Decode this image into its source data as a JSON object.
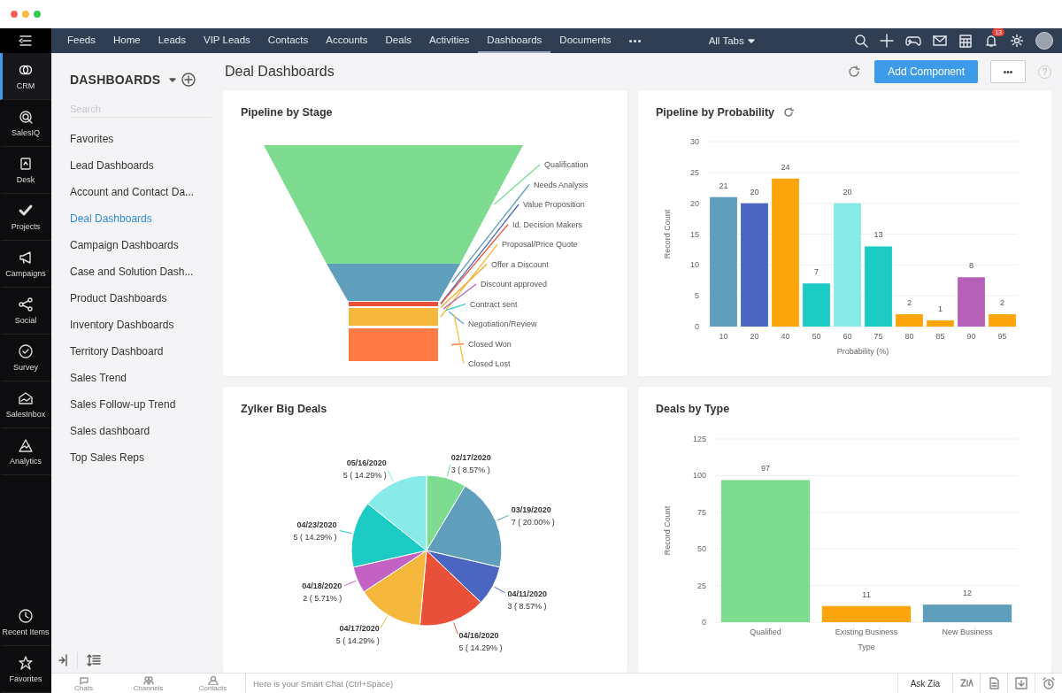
{
  "rail": {
    "items": [
      {
        "label": "CRM",
        "selected": true
      },
      {
        "label": "SalesIQ",
        "selected": false
      },
      {
        "label": "Desk",
        "selected": false
      },
      {
        "label": "Projects",
        "selected": false
      },
      {
        "label": "Campaigns",
        "selected": false
      },
      {
        "label": "Social",
        "selected": false
      },
      {
        "label": "Survey",
        "selected": false
      },
      {
        "label": "SalesInbox",
        "selected": false
      },
      {
        "label": "Analytics",
        "selected": false
      }
    ],
    "bottom_items": [
      {
        "label": "Recent Items"
      },
      {
        "label": "Favorites"
      }
    ]
  },
  "nav": {
    "tabs": [
      {
        "label": "Feeds",
        "selected": false
      },
      {
        "label": "Home",
        "selected": false
      },
      {
        "label": "Leads",
        "selected": false
      },
      {
        "label": "VIP Leads",
        "selected": false
      },
      {
        "label": "Contacts",
        "selected": false
      },
      {
        "label": "Accounts",
        "selected": false
      },
      {
        "label": "Deals",
        "selected": false
      },
      {
        "label": "Activities",
        "selected": false
      },
      {
        "label": "Dashboards",
        "selected": true
      },
      {
        "label": "Documents",
        "selected": false
      }
    ],
    "more": "•••",
    "all_tabs": "All Tabs",
    "notification_count": "13"
  },
  "sidebar": {
    "title": "DASHBOARDS",
    "search": {
      "placeholder": "Search"
    },
    "items": [
      {
        "label": "Favorites",
        "selected": false
      },
      {
        "label": "Lead Dashboards",
        "selected": false
      },
      {
        "label": "Account and Contact Da...",
        "selected": false
      },
      {
        "label": "Deal Dashboards",
        "selected": true
      },
      {
        "label": "Campaign Dashboards",
        "selected": false
      },
      {
        "label": "Case and Solution Dash...",
        "selected": false
      },
      {
        "label": "Product Dashboards",
        "selected": false
      },
      {
        "label": "Inventory Dashboards",
        "selected": false
      },
      {
        "label": "Territory Dashboard",
        "selected": false
      },
      {
        "label": "Sales Trend",
        "selected": false
      },
      {
        "label": "Sales Follow-up Trend",
        "selected": false
      },
      {
        "label": "Sales dashboard",
        "selected": false
      },
      {
        "label": "Top Sales Reps",
        "selected": false
      }
    ]
  },
  "header": {
    "title": "Deal Dashboards",
    "add_button": "Add Component",
    "more_button": "•••",
    "help": "?"
  },
  "cards": [
    {
      "kind": "funnel",
      "title": "Pipeline by Stage",
      "refresh": false,
      "stages": [
        {
          "label": "Qualification",
          "color": "#7ddc8f"
        },
        {
          "label": "Needs Analysis",
          "color": "#5f9fbc"
        },
        {
          "label": "Value Proposition",
          "color": "#4a66c0"
        },
        {
          "label": "Id. Decision Makers",
          "color": "#e8503a"
        },
        {
          "label": "Proposal/Price Quote",
          "color": "#f5b83d"
        },
        {
          "label": "Offer a Discount",
          "color": "#f5a623"
        },
        {
          "label": "Discount approved",
          "color": "#b660b8"
        },
        {
          "label": "Contract sent",
          "color": "#23cbc5"
        },
        {
          "label": "Negotiation/Review",
          "color": "#5fa8d8"
        },
        {
          "label": "Closed Won",
          "color": "#ff7a45"
        },
        {
          "label": "Closed Lost",
          "color": "#f5c542"
        }
      ]
    },
    {
      "kind": "bar",
      "title": "Pipeline by Probability",
      "refresh": true,
      "chart_data": {
        "type": "bar",
        "xlabel": "Probability (%)",
        "ylabel": "Record Count",
        "categories": [
          "10",
          "20",
          "40",
          "50",
          "60",
          "75",
          "80",
          "85",
          "90",
          "95"
        ],
        "series": [
          {
            "values": [
              21,
              20,
              24,
              7,
              20,
              13,
              2,
              1,
              8,
              2
            ]
          }
        ],
        "grid": true,
        "colors": [
          "#5f9fbc",
          "#4a66c0",
          "#fca40b",
          "#1ccbc4",
          "#88ebe9",
          "#1ccbc4",
          "#fca40b",
          "#fca40b",
          "#b660b8",
          "#fca40b"
        ],
        "ylim": [
          0,
          30
        ],
        "yticks": [
          0,
          5,
          10,
          15,
          20,
          25,
          30
        ],
        "data_labels": true
      }
    },
    {
      "kind": "pie",
      "title": "Zylker Big Deals",
      "refresh": false,
      "chart_data": {
        "type": "pie",
        "categories": [
          "02/17/2020",
          "03/19/2020",
          "04/11/2020",
          "04/16/2020",
          "04/17/2020",
          "04/18/2020",
          "04/23/2020",
          "05/16/2020"
        ],
        "series": [
          {
            "values": [
              3,
              7,
              3,
              5,
              5,
              2,
              5,
              5
            ]
          }
        ],
        "colors": [
          "#7ddc8f",
          "#5f9fbc",
          "#4a66c0",
          "#e8503a",
          "#f5b83d",
          "#c362c2",
          "#1ccbc4",
          "#88ebe9"
        ],
        "value_labels": [
          "3 ( 8.57% )",
          "7 ( 20.00% )",
          "3 ( 8.57% )",
          "5 ( 14.29% )",
          "5 ( 14.29% )",
          "2 ( 5.71% )",
          "5 ( 14.29% )",
          "5 ( 14.29% )"
        ]
      }
    },
    {
      "kind": "bar",
      "title": "Deals by Type",
      "refresh": false,
      "chart_data": {
        "type": "bar",
        "xlabel": "Type",
        "ylabel": "Record Count",
        "categories": [
          "Qualified",
          "Existing Business",
          "New Business"
        ],
        "series": [
          {
            "values": [
              97,
              11,
              12
            ]
          }
        ],
        "grid": true,
        "colors": [
          "#7ddc8f",
          "#fca40b",
          "#5f9fbc"
        ],
        "ylim": [
          0,
          125
        ],
        "yticks": [
          0,
          25,
          50,
          75,
          100,
          125
        ],
        "data_labels": true
      }
    }
  ],
  "bottom_bar": {
    "shortcuts": [
      {
        "label": "Chats"
      },
      {
        "label": "Channels"
      },
      {
        "label": "Contacts"
      }
    ],
    "chat_placeholder": "Here is your Smart Chat (Ctrl+Space)",
    "ask_zia": "Ask Zia"
  }
}
